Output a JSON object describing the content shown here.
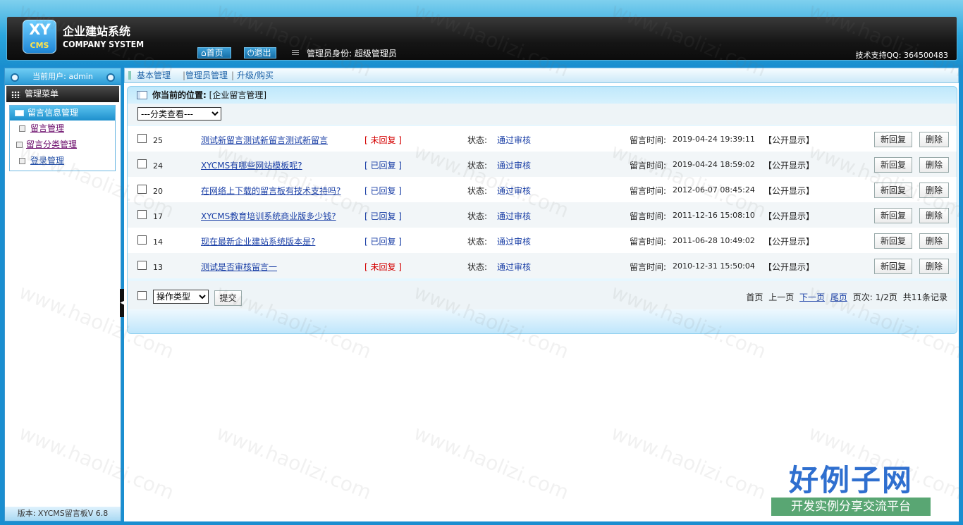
{
  "header": {
    "logo_xy": "XY",
    "logo_cms": "CMS",
    "brand_cn": "企业建站系统",
    "brand_en": "COMPANY SYSTEM",
    "home_label": "首页",
    "logout_label": "退出",
    "identity": "管理员身份: 超级管理员",
    "support": "技术支持QQ: 364500483"
  },
  "sidebar": {
    "current_user": "当前用户: admin",
    "menu_header": "管理菜单",
    "section_title": "留言信息管理",
    "items": [
      {
        "label": "留言管理"
      },
      {
        "label": "留言分类管理"
      },
      {
        "label": "登录管理"
      }
    ],
    "version": "版本: XYCMS留言板V 6.8"
  },
  "topnav": {
    "links": [
      "基本管理",
      "管理员管理",
      "升级/购买"
    ],
    "separator": "|"
  },
  "panel": {
    "crumb_label": "你当前的位置:",
    "crumb_value": "[企业留言管理]",
    "filter_selected": "---分类查看---",
    "status_label": "状态:",
    "time_label": "留言时间:",
    "reply_button": "新回复",
    "delete_button": "删除",
    "rows": [
      {
        "id": "25",
        "title": "测试新留言测试新留言测试新留言",
        "reply": "[ 未回复 ]",
        "replied": false,
        "status": "通过审核",
        "time": "2019-04-24 19:39:11",
        "public": "【公开显示】"
      },
      {
        "id": "24",
        "title": "XYCMS有哪些网站模板呢?",
        "reply": "[ 已回复 ]",
        "replied": true,
        "status": "通过审核",
        "time": "2019-04-24 18:59:02",
        "public": "【公开显示】"
      },
      {
        "id": "20",
        "title": "在网络上下载的留言板有技术支持吗?",
        "reply": "[ 已回复 ]",
        "replied": true,
        "status": "通过审核",
        "time": "2012-06-07 08:45:24",
        "public": "【公开显示】"
      },
      {
        "id": "17",
        "title": "XYCMS教育培训系统商业版多少钱?",
        "reply": "[ 已回复 ]",
        "replied": true,
        "status": "通过审核",
        "time": "2011-12-16 15:08:10",
        "public": "【公开显示】"
      },
      {
        "id": "14",
        "title": "现在最新企业建站系统版本是?",
        "reply": "[ 已回复 ]",
        "replied": true,
        "status": "通过审核",
        "time": "2011-06-28 10:49:02",
        "public": "【公开显示】"
      },
      {
        "id": "13",
        "title": "测试是否审核留言一",
        "reply": "[ 未回复 ]",
        "replied": false,
        "status": "通过审核",
        "time": "2010-12-31 15:50:04",
        "public": "【公开显示】"
      }
    ],
    "op_selected": "操作类型",
    "submit_label": "提交",
    "pager": {
      "first": "首页",
      "prev": "上一页",
      "next": "下一页",
      "last": "尾页",
      "page_info": "页次: 1/2页",
      "total": "共11条记录"
    }
  },
  "watermark": {
    "text": "www.haolizi.com",
    "brand_big": "好例子网",
    "brand_small": "开发实例分享交流平台"
  },
  "colors": {
    "accent": "#1a8ed0",
    "header_dark": "#151515",
    "unreplied": "#d40000",
    "link": "#1a3fa6"
  }
}
